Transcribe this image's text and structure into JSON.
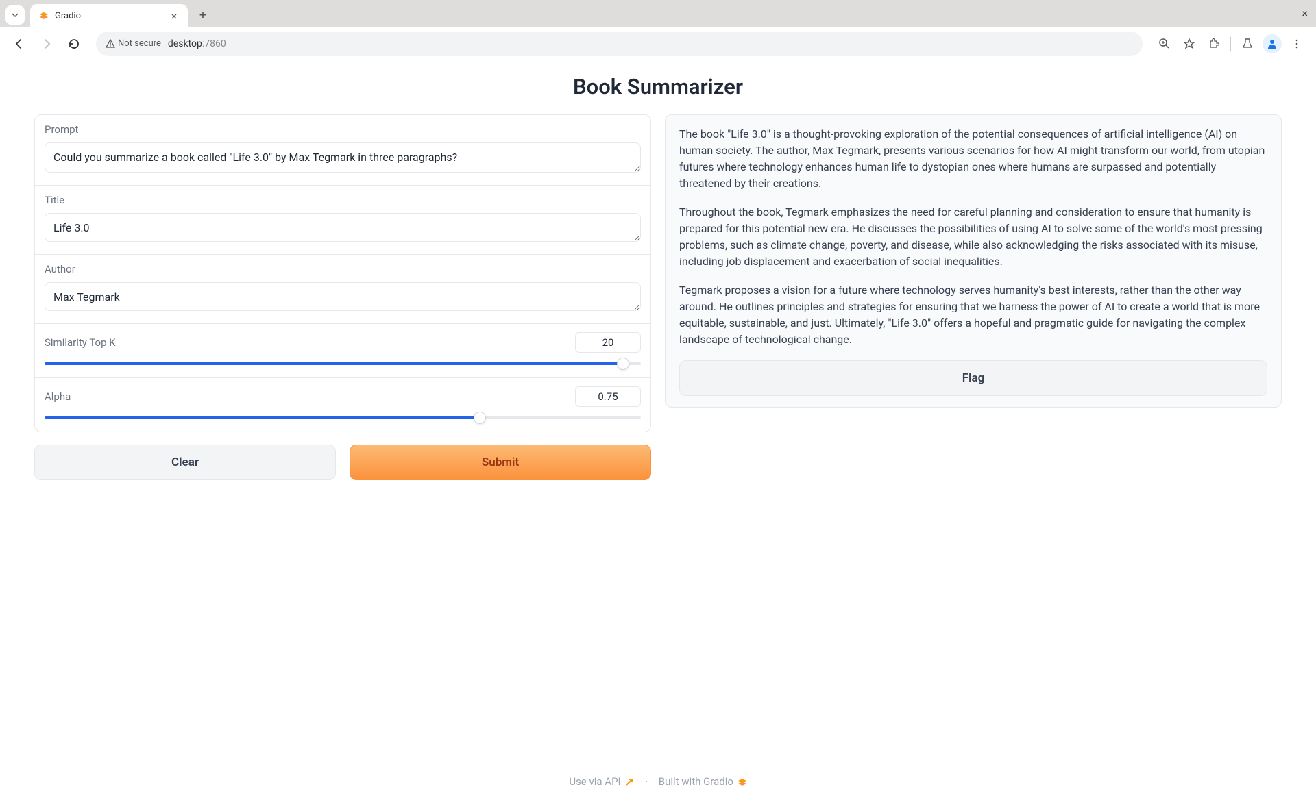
{
  "browser": {
    "tab_title": "Gradio",
    "url_host": "desktop",
    "url_port": ":7860",
    "security_text": "Not secure"
  },
  "page": {
    "title": "Book Summarizer"
  },
  "form": {
    "prompt": {
      "label": "Prompt",
      "value": "Could you summarize a book called \"Life 3.0\" by Max Tegmark in three paragraphs?"
    },
    "title": {
      "label": "Title",
      "value": "Life 3.0"
    },
    "author": {
      "label": "Author",
      "value": "Max Tegmark"
    },
    "topk": {
      "label": "Similarity Top K",
      "value": "20",
      "fill_pct": 97
    },
    "alpha": {
      "label": "Alpha",
      "value": "0.75",
      "fill_pct": 73
    }
  },
  "buttons": {
    "clear": "Clear",
    "submit": "Submit",
    "flag": "Flag"
  },
  "output": {
    "p1": "The book \"Life 3.0\" is a thought-provoking exploration of the potential consequences of artificial intelligence (AI) on human society. The author, Max Tegmark, presents various scenarios for how AI might transform our world, from utopian futures where technology enhances human life to dystopian ones where humans are surpassed and potentially threatened by their creations.",
    "p2": "Throughout the book, Tegmark emphasizes the need for careful planning and consideration to ensure that humanity is prepared for this potential new era. He discusses the possibilities of using AI to solve some of the world's most pressing problems, such as climate change, poverty, and disease, while also acknowledging the risks associated with its misuse, including job displacement and exacerbation of social inequalities.",
    "p3": "Tegmark proposes a vision for a future where technology serves humanity's best interests, rather than the other way around. He outlines principles and strategies for ensuring that we harness the power of AI to create a world that is more equitable, sustainable, and just. Ultimately, \"Life 3.0\" offers a hopeful and pragmatic guide for navigating the complex landscape of technological change."
  },
  "footer": {
    "api_text": "Use via API",
    "built_text": "Built with Gradio"
  }
}
